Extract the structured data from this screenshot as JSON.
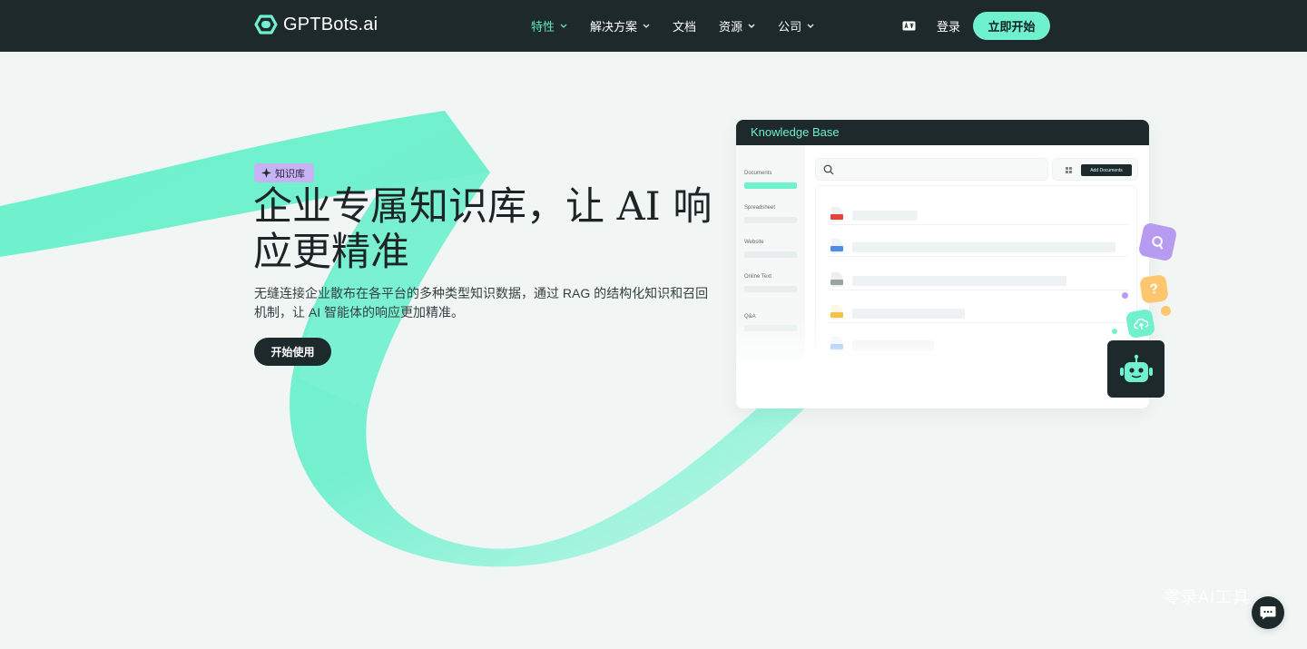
{
  "nav": {
    "logo_text": "GPTBots.ai",
    "items": [
      {
        "label": "特性",
        "has_dropdown": true,
        "active": true
      },
      {
        "label": "解决方案",
        "has_dropdown": true,
        "active": false
      },
      {
        "label": "文档",
        "has_dropdown": false,
        "active": false
      },
      {
        "label": "资源",
        "has_dropdown": true,
        "active": false
      },
      {
        "label": "公司",
        "has_dropdown": true,
        "active": false
      }
    ],
    "language_icon": "language-icon",
    "login_label": "登录",
    "cta_label": "立即开始"
  },
  "hero": {
    "tag_label": "知识库",
    "title": "企业专属知识库，让 AI 响应更精准",
    "description": "无缝连接企业散布在各平台的多种类型知识数据，通过 RAG 的结构化知识和召回机制，让 AI 智能体的响应更加精准。",
    "cta_label": "开始使用"
  },
  "kb_panel": {
    "title": "Knowledge Base",
    "sidebar": [
      "Documents",
      "Spreadsheet",
      "Website",
      "Online Text",
      "Q&A"
    ],
    "add_button": "Add Documents",
    "file_types": [
      "pdf",
      "docx",
      "txt",
      "xlsx",
      "doc"
    ]
  },
  "floating_icons": [
    "search-icon",
    "question-icon",
    "cloud-upload-icon",
    "robot-icon"
  ],
  "watermark": "零录AI工具",
  "colors": {
    "nav_bg": "#1e292b",
    "accent": "#6ff1cd",
    "accent_text": "#5eeac1",
    "tag_bg": "#c6b3f3",
    "page_bg": "#f1f5f4"
  }
}
